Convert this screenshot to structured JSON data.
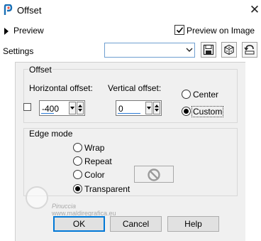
{
  "window": {
    "title": "Offset",
    "close_glyph": "✕"
  },
  "preview": {
    "toggle_label": "Preview",
    "preview_on_image_label": "Preview on Image",
    "preview_on_image_checked": true
  },
  "settings": {
    "label": "Settings",
    "preset_value": ""
  },
  "offset": {
    "group_title": "Offset",
    "horizontal_label": "Horizontal offset:",
    "horizontal_value": "-400",
    "vertical_label": "Vertical offset:",
    "vertical_value": "0",
    "center_label": "Center",
    "custom_label": "Custom",
    "selected": "Custom"
  },
  "edge_mode": {
    "group_title": "Edge mode",
    "options": [
      "Wrap",
      "Repeat",
      "Color",
      "Transparent"
    ],
    "selected": "Transparent"
  },
  "watermark": {
    "name": "Pinuccia",
    "url": "www.maldiregrafica.eu"
  },
  "buttons": {
    "ok": "OK",
    "cancel": "Cancel",
    "help": "Help"
  },
  "colors": {
    "accent": "#0078d7",
    "panel_bg": "#f0f0f0",
    "field_underline": "#2c7bd6"
  }
}
